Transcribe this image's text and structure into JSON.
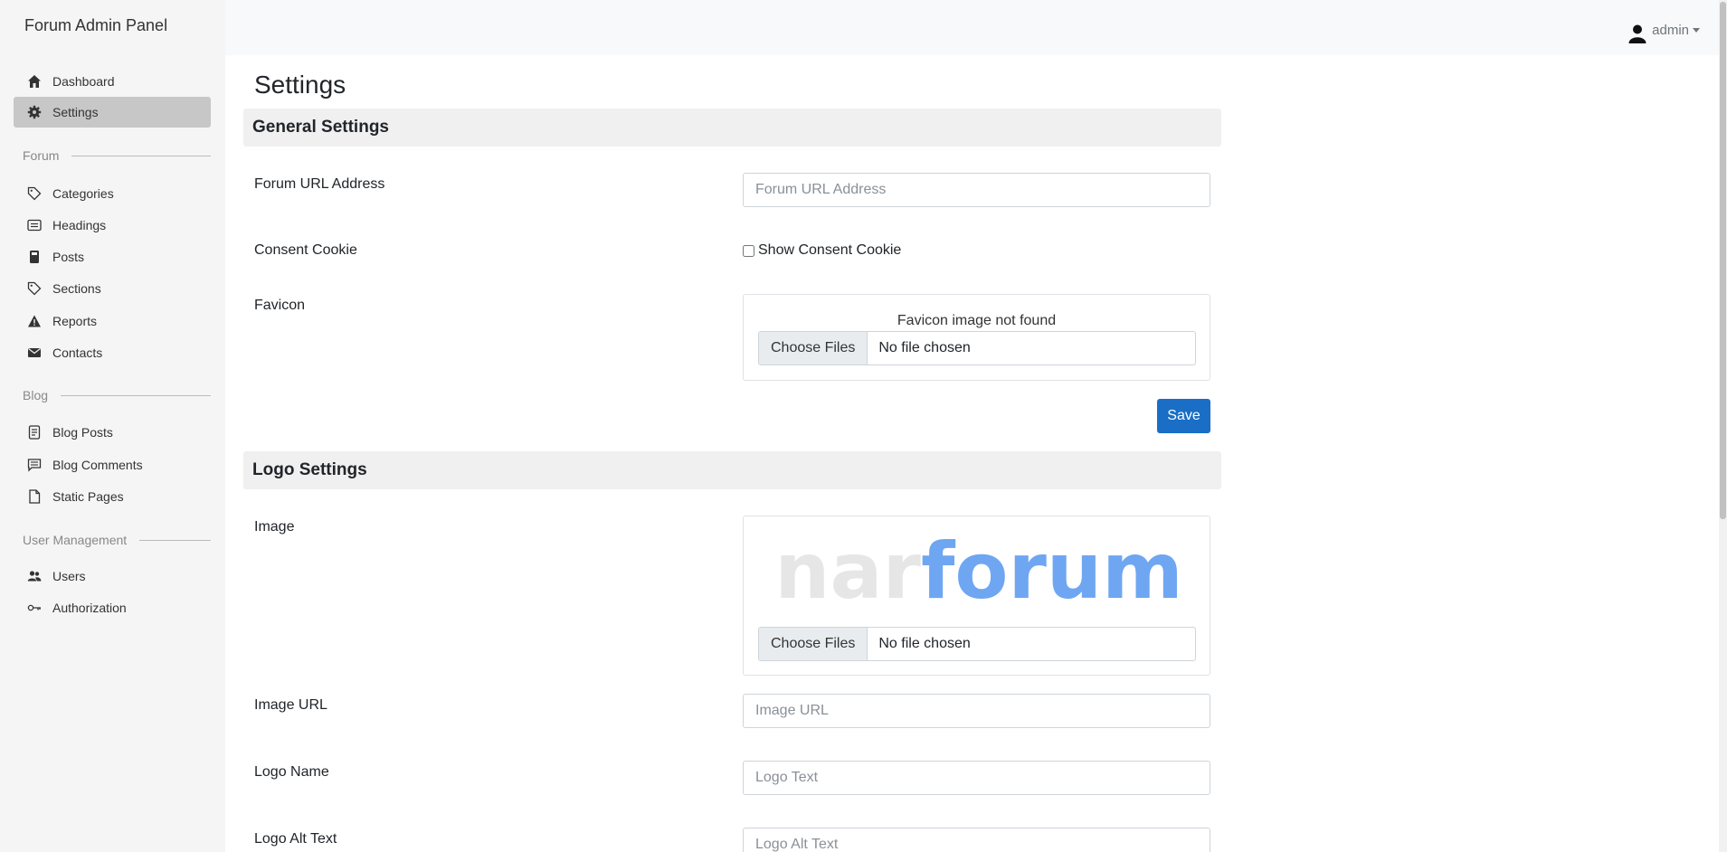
{
  "brand": "Forum Admin Panel",
  "user": {
    "name": "admin"
  },
  "sidebar": {
    "items_top": [
      {
        "label": "Dashboard",
        "icon": "home-icon"
      },
      {
        "label": "Settings",
        "icon": "gear-icon",
        "active": true
      }
    ],
    "forum_heading": "Forum",
    "forum_items": [
      {
        "label": "Categories",
        "icon": "tag-icon"
      },
      {
        "label": "Headings",
        "icon": "card-icon"
      },
      {
        "label": "Posts",
        "icon": "file-icon"
      },
      {
        "label": "Sections",
        "icon": "tag-icon"
      },
      {
        "label": "Reports",
        "icon": "warning-icon"
      },
      {
        "label": "Contacts",
        "icon": "envelope-icon"
      }
    ],
    "blog_heading": "Blog",
    "blog_items": [
      {
        "label": "Blog Posts",
        "icon": "blog-post-icon"
      },
      {
        "label": "Blog Comments",
        "icon": "comment-icon"
      },
      {
        "label": "Static Pages",
        "icon": "page-icon"
      }
    ],
    "user_heading": "User Management",
    "user_items": [
      {
        "label": "Users",
        "icon": "users-icon"
      },
      {
        "label": "Authorization",
        "icon": "key-icon"
      }
    ]
  },
  "page_title": "Settings",
  "general": {
    "header": "General Settings",
    "forum_url_label": "Forum URL Address",
    "forum_url_placeholder": "Forum URL Address",
    "consent_label": "Consent Cookie",
    "consent_checkbox_label": "Show Consent Cookie",
    "favicon_label": "Favicon",
    "favicon_msg": "Favicon image not found",
    "choose_files": "Choose Files",
    "no_file": "No file chosen",
    "save": "Save"
  },
  "logo": {
    "header": "Logo Settings",
    "image_label": "Image",
    "logo_text_part1": "nar",
    "logo_text_part2": "forum",
    "choose_files": "Choose Files",
    "no_file": "No file chosen",
    "image_url_label": "Image URL",
    "image_url_placeholder": "Image URL",
    "logo_name_label": "Logo Name",
    "logo_name_placeholder": "Logo Text",
    "alt_label": "Logo Alt Text",
    "alt_placeholder": "Logo Alt Text"
  },
  "colors": {
    "active_bg": "#c7c7c7",
    "save_bg": "#1a6ec5",
    "logo_blue": "#5a9cf0",
    "logo_gray": "#e6e6e6"
  }
}
